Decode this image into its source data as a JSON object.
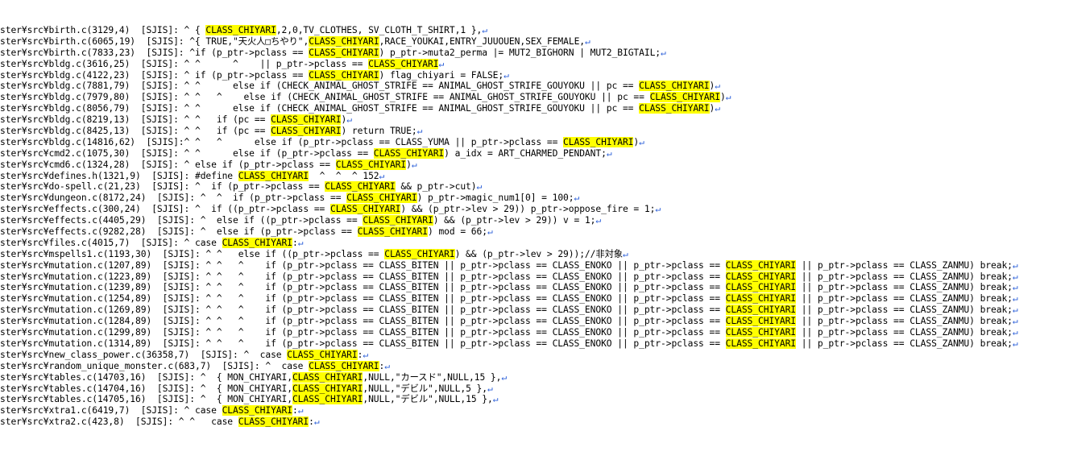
{
  "editor": {
    "newline_glyph": "↵",
    "highlight_term": "CLASS_CHIYARI",
    "lines": [
      {
        "text": "ster¥src¥birth.c(3129,4)  [SJIS]: ^ { CLASS_CHIYARI,2,0,TV_CLOTHES, SV_CLOTH_T_SHIRT,1 },"
      },
      {
        "text": "ster¥src¥birth.c(6065,19)  [SJIS]: ^{ TRUE,\"天火人□ちやり\",CLASS_CHIYARI,RACE_YOUKAI,ENTRY_JUUOUEN,SEX_FEMALE,"
      },
      {
        "text": "ster¥src¥birth.c(7833,23)  [SJIS]: ^if (p_ptr->pclass == CLASS_CHIYARI) p_ptr->muta2_perma |= MUT2_BIGHORN | MUT2_BIGTAIL;"
      },
      {
        "text": "ster¥src¥bldg.c(3616,25)  [SJIS]: ^ ^      ^    || p_ptr->pclass == CLASS_CHIYARI"
      },
      {
        "text": "ster¥src¥bldg.c(4122,23)  [SJIS]: ^ if (p_ptr->pclass == CLASS_CHIYARI) flag_chiyari = FALSE;"
      },
      {
        "text": "ster¥src¥bldg.c(7881,79)  [SJIS]: ^ ^      else if (CHECK_ANIMAL_GHOST_STRIFE == ANIMAL_GHOST_STRIFE_GOUYOKU || pc == CLASS_CHIYARI)"
      },
      {
        "text": "ster¥src¥bldg.c(7979,80)  [SJIS]: ^ ^   ^    else if (CHECK_ANIMAL_GHOST_STRIFE == ANIMAL_GHOST_STRIFE_GOUYOKU || pc == CLASS_CHIYARI)"
      },
      {
        "text": "ster¥src¥bldg.c(8056,79)  [SJIS]: ^ ^      else if (CHECK_ANIMAL_GHOST_STRIFE == ANIMAL_GHOST_STRIFE_GOUYOKU || pc == CLASS_CHIYARI)"
      },
      {
        "text": "ster¥src¥bldg.c(8219,13)  [SJIS]: ^ ^   if (pc == CLASS_CHIYARI)"
      },
      {
        "text": "ster¥src¥bldg.c(8425,13)  [SJIS]: ^ ^   if (pc == CLASS_CHIYARI) return TRUE;"
      },
      {
        "text": "ster¥src¥bldg.c(14816,62)  [SJIS]:^ ^   ^      else if (p_ptr->pclass == CLASS_YUMA || p_ptr->pclass == CLASS_CHIYARI)"
      },
      {
        "text": "ster¥src¥cmd2.c(1075,30)  [SJIS]: ^ ^      else if (p_ptr->pclass == CLASS_CHIYARI) a_idx = ART_CHARMED_PENDANT;"
      },
      {
        "text": "ster¥src¥cmd6.c(1324,28)  [SJIS]: ^ else if (p_ptr->pclass == CLASS_CHIYARI)"
      },
      {
        "text": "ster¥src¥defines.h(1321,9)  [SJIS]: #define CLASS_CHIYARI  ^  ^  ^ 152"
      },
      {
        "text": "ster¥src¥do-spell.c(21,23)  [SJIS]: ^  if (p_ptr->pclass == CLASS_CHIYARI && p_ptr->cut)"
      },
      {
        "text": "ster¥src¥dungeon.c(8172,24)  [SJIS]: ^  ^  if (p_ptr->pclass == CLASS_CHIYARI) p_ptr->magic_num1[0] = 100;"
      },
      {
        "text": "ster¥src¥effects.c(300,24)  [SJIS]: ^  if ((p_ptr->pclass == CLASS_CHIYARI) && (p_ptr->lev > 29)) p_ptr->oppose_fire = 1;"
      },
      {
        "text": "ster¥src¥effects.c(4405,29)  [SJIS]: ^  else if ((p_ptr->pclass == CLASS_CHIYARI) && (p_ptr->lev > 29)) v = 1;"
      },
      {
        "text": "ster¥src¥effects.c(9282,28)  [SJIS]: ^  else if (p_ptr->pclass == CLASS_CHIYARI) mod = 66;"
      },
      {
        "text": "ster¥src¥files.c(4015,7)  [SJIS]: ^ case CLASS_CHIYARI:"
      },
      {
        "text": "ster¥src¥mspells1.c(1193,30)  [SJIS]: ^ ^   else if ((p_ptr->pclass == CLASS_CHIYARI) && (p_ptr->lev > 29));//非対象"
      },
      {
        "text": "ster¥src¥mutation.c(1207,89)  [SJIS]: ^ ^   ^    if (p_ptr->pclass == CLASS_BITEN || p_ptr->pclass == CLASS_ENOKO || p_ptr->pclass == CLASS_CHIYARI || p_ptr->pclass == CLASS_ZANMU) break;"
      },
      {
        "text": "ster¥src¥mutation.c(1223,89)  [SJIS]: ^ ^   ^    if (p_ptr->pclass == CLASS_BITEN || p_ptr->pclass == CLASS_ENOKO || p_ptr->pclass == CLASS_CHIYARI || p_ptr->pclass == CLASS_ZANMU) break;"
      },
      {
        "text": "ster¥src¥mutation.c(1239,89)  [SJIS]: ^ ^   ^    if (p_ptr->pclass == CLASS_BITEN || p_ptr->pclass == CLASS_ENOKO || p_ptr->pclass == CLASS_CHIYARI || p_ptr->pclass == CLASS_ZANMU) break;"
      },
      {
        "text": "ster¥src¥mutation.c(1254,89)  [SJIS]: ^ ^   ^    if (p_ptr->pclass == CLASS_BITEN || p_ptr->pclass == CLASS_ENOKO || p_ptr->pclass == CLASS_CHIYARI || p_ptr->pclass == CLASS_ZANMU) break;"
      },
      {
        "text": "ster¥src¥mutation.c(1269,89)  [SJIS]: ^ ^   ^    if (p_ptr->pclass == CLASS_BITEN || p_ptr->pclass == CLASS_ENOKO || p_ptr->pclass == CLASS_CHIYARI || p_ptr->pclass == CLASS_ZANMU) break;"
      },
      {
        "text": "ster¥src¥mutation.c(1284,89)  [SJIS]: ^ ^   ^    if (p_ptr->pclass == CLASS_BITEN || p_ptr->pclass == CLASS_ENOKO || p_ptr->pclass == CLASS_CHIYARI || p_ptr->pclass == CLASS_ZANMU) break;"
      },
      {
        "text": "ster¥src¥mutation.c(1299,89)  [SJIS]: ^ ^   ^    if (p_ptr->pclass == CLASS_BITEN || p_ptr->pclass == CLASS_ENOKO || p_ptr->pclass == CLASS_CHIYARI || p_ptr->pclass == CLASS_ZANMU) break;"
      },
      {
        "text": "ster¥src¥mutation.c(1314,89)  [SJIS]: ^ ^   ^    if (p_ptr->pclass == CLASS_BITEN || p_ptr->pclass == CLASS_ENOKO || p_ptr->pclass == CLASS_CHIYARI || p_ptr->pclass == CLASS_ZANMU) break;"
      },
      {
        "text": "ster¥src¥new_class_power.c(36358,7)  [SJIS]: ^  case CLASS_CHIYARI:"
      },
      {
        "text": "ster¥src¥random_unique_monster.c(683,7)  [SJIS]: ^  case CLASS_CHIYARI:"
      },
      {
        "text": "ster¥src¥tables.c(14703,16)  [SJIS]: ^  { MON_CHIYARI,CLASS_CHIYARI,NULL,\"カースド\",NULL,15 },"
      },
      {
        "text": "ster¥src¥tables.c(14704,16)  [SJIS]: ^  { MON_CHIYARI,CLASS_CHIYARI,NULL,\"デビル\",NULL,5 },"
      },
      {
        "text": "ster¥src¥tables.c(14705,16)  [SJIS]: ^  { MON_CHIYARI,CLASS_CHIYARI,NULL,\"デビル\",NULL,15 },"
      },
      {
        "text": "ster¥src¥xtra1.c(6419,7)  [SJIS]: ^ case CLASS_CHIYARI:"
      },
      {
        "text": "ster¥src¥xtra2.c(423,8)  [SJIS]: ^ ^   case CLASS_CHIYARI:"
      }
    ]
  }
}
